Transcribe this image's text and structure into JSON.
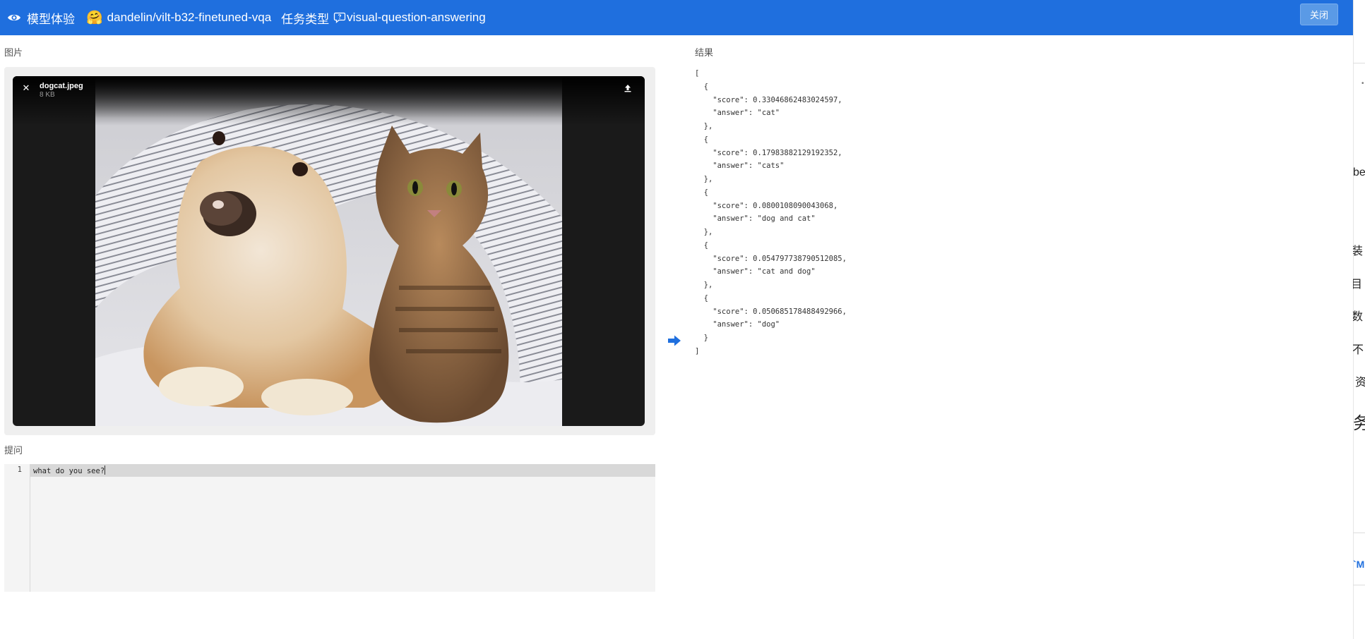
{
  "header": {
    "title": "模型体验",
    "hf_emoji": "🤗",
    "model": "dandelin/vilt-b32-finetuned-vqa",
    "task_label": "任务类型",
    "task": "visual-question-answering",
    "close_label": "关闭"
  },
  "image_section": {
    "label": "图片",
    "file_name": "dogcat.jpeg",
    "file_size": "8 KB"
  },
  "question_section": {
    "label": "提问",
    "line_number": "1",
    "text": "what do you see?"
  },
  "result_section": {
    "label": "结果",
    "json_text": "[\n  {\n    \"score\": 0.33046862483024597,\n    \"answer\": \"cat\"\n  },\n  {\n    \"score\": 0.17983882129192352,\n    \"answer\": \"cats\"\n  },\n  {\n    \"score\": 0.0800108090043068,\n    \"answer\": \"dog and cat\"\n  },\n  {\n    \"score\": 0.054797738790512085,\n    \"answer\": \"cat and dog\"\n  },\n  {\n    \"score\": 0.050685178488492966,\n    \"answer\": \"dog\"\n  }\n]"
  },
  "right_strip": {
    "fragments": [
      "be",
      "装",
      "目",
      "数",
      "不",
      "资",
      "务"
    ]
  },
  "colors": {
    "header_bg": "#1f6fde",
    "arrow": "#1f6fde"
  }
}
